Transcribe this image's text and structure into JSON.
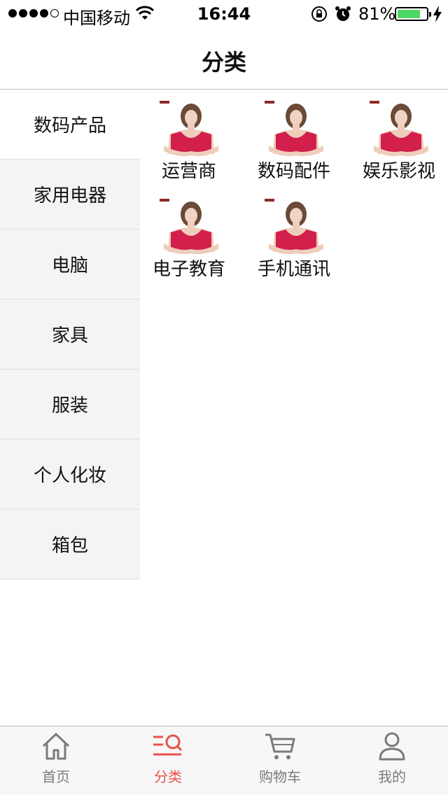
{
  "status_bar": {
    "carrier": "中国移动",
    "time": "16:44",
    "battery_percent": "81%",
    "battery_level": 0.81,
    "icons": [
      "signal-dots",
      "wifi-icon",
      "rotation-lock-icon",
      "alarm-icon",
      "battery-icon",
      "charging-bolt-icon"
    ]
  },
  "nav": {
    "title": "分类"
  },
  "sidebar": {
    "items": [
      {
        "label": "数码产品",
        "active": true
      },
      {
        "label": "家用电器"
      },
      {
        "label": "电脑"
      },
      {
        "label": "家具"
      },
      {
        "label": "服装"
      },
      {
        "label": "个人化妆"
      },
      {
        "label": "箱包"
      }
    ]
  },
  "grid": {
    "items": [
      {
        "label": "运营商"
      },
      {
        "label": "数码配件"
      },
      {
        "label": "娱乐影视"
      },
      {
        "label": "电子教育"
      },
      {
        "label": "手机通讯"
      }
    ]
  },
  "tab_bar": {
    "tabs": [
      {
        "label": "首页",
        "icon": "home-icon"
      },
      {
        "label": "分类",
        "icon": "category-icon",
        "active": true
      },
      {
        "label": "购物车",
        "icon": "cart-icon"
      },
      {
        "label": "我的",
        "icon": "profile-icon"
      }
    ]
  },
  "colors": {
    "accent": "#e8524a",
    "sidebar_bg": "#f4f4f4",
    "battery": "#4cd964",
    "product_red": "#d21f4c"
  }
}
